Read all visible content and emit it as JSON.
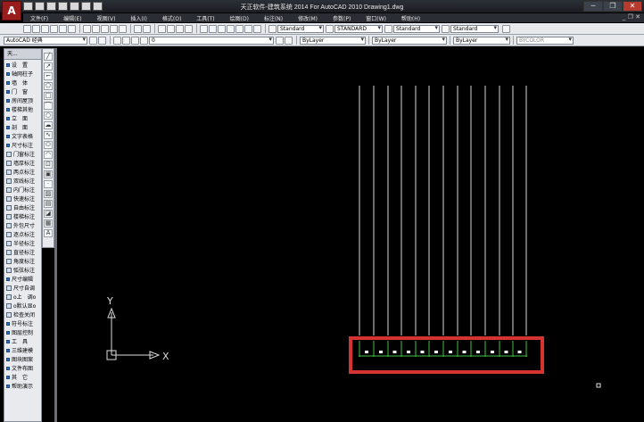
{
  "app": {
    "logo_letter": "A",
    "title": "天正软件-建筑系统 2014  For AutoCAD 2010     Drawing1.dwg",
    "window_buttons": [
      "─",
      "❐",
      "✕"
    ]
  },
  "menu": {
    "items": [
      "文件(F)",
      "编辑(E)",
      "视图(V)",
      "插入(I)",
      "格式(O)",
      "工具(T)",
      "绘图(D)",
      "标注(N)",
      "修改(M)",
      "参数(P)",
      "窗口(W)",
      "帮助(H)"
    ],
    "controls": "_ ❐ ✕"
  },
  "toolbar1": {
    "text_style_value": "Standard",
    "dim_style_value": "STANDARD",
    "table_style_value": "Standard",
    "mleader_style_value": "Standard"
  },
  "toolbar2": {
    "workspace_value": "AutoCAD 经典",
    "layer_value": "0",
    "color_value": "ByLayer",
    "linetype_value": "ByLayer",
    "lineweight_value": "ByLayer",
    "plotstyle_value": "BYCOLOR"
  },
  "palette": {
    "title": "天...",
    "items": [
      {
        "label": "设　置",
        "cat": true
      },
      {
        "label": "轴网柱子",
        "cat": true
      },
      {
        "label": "墙　体",
        "cat": true
      },
      {
        "label": "门　窗",
        "cat": true
      },
      {
        "label": "房间屋顶",
        "cat": true
      },
      {
        "label": "楼梯其他",
        "cat": true
      },
      {
        "label": "立　面",
        "cat": true
      },
      {
        "label": "剖　面",
        "cat": true
      },
      {
        "label": "文字表格",
        "cat": true
      },
      {
        "label": "尺寸标注",
        "cat": true
      },
      {
        "label": "门窗标注",
        "cat": false
      },
      {
        "label": "墙厚标注",
        "cat": false
      },
      {
        "label": "两点标注",
        "cat": false
      },
      {
        "label": "双线标注",
        "cat": false
      },
      {
        "label": "内门标注",
        "cat": false
      },
      {
        "label": "快速标注",
        "cat": false
      },
      {
        "label": "自由标注",
        "cat": false
      },
      {
        "label": "楼梯标注",
        "cat": false
      },
      {
        "label": "外包尺寸",
        "cat": false
      },
      {
        "label": "逐点标注",
        "cat": false
      },
      {
        "label": "半径标注",
        "cat": false
      },
      {
        "label": "直径标注",
        "cat": false
      },
      {
        "label": "角度标注",
        "cat": false
      },
      {
        "label": "弧弦标注",
        "cat": false
      },
      {
        "label": "尺寸编辑",
        "cat": true
      },
      {
        "label": "尺寸自调",
        "cat": false
      },
      {
        "label": "o上　调o",
        "cat": false
      },
      {
        "label": "o默认显o",
        "cat": false
      },
      {
        "label": "检查关闭",
        "cat": false
      },
      {
        "label": "符号标注",
        "cat": true
      },
      {
        "label": "图层控制",
        "cat": true
      },
      {
        "label": "工　具",
        "cat": true
      },
      {
        "label": "三维建模",
        "cat": true
      },
      {
        "label": "图块图案",
        "cat": true
      },
      {
        "label": "文件布图",
        "cat": true
      },
      {
        "label": "其　它",
        "cat": true
      },
      {
        "label": "帮助演示",
        "cat": true
      }
    ]
  },
  "ucs": {
    "x_label": "X",
    "y_label": "Y"
  },
  "colors": {
    "highlight": "#d53232",
    "canvas": "#000000",
    "dim_green": "#3fbf3f"
  }
}
